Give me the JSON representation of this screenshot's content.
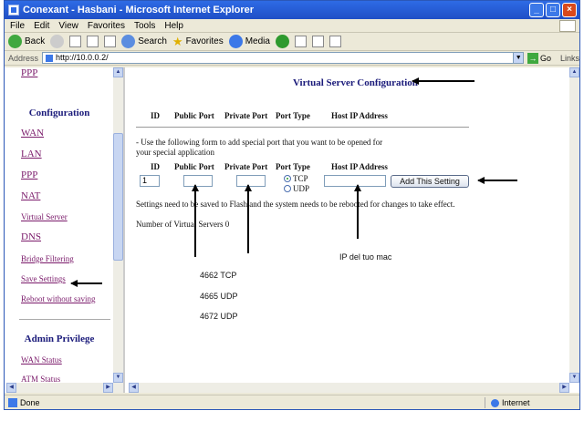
{
  "window": {
    "title": "Conexant - Hasbani - Microsoft Internet Explorer"
  },
  "menu": [
    "File",
    "Edit",
    "View",
    "Favorites",
    "Tools",
    "Help"
  ],
  "toolbar": {
    "back": "Back",
    "search": "Search",
    "favorites": "Favorites",
    "media": "Media"
  },
  "address": {
    "label": "Address",
    "url": "http://10.0.0.2/",
    "go": "Go",
    "links": "Links"
  },
  "sidebar": {
    "top_link": "PPP",
    "section1": "Configuration",
    "items": [
      "WAN",
      "LAN",
      "PPP",
      "NAT",
      "Virtual Server",
      "DNS",
      "Bridge Filtering",
      "Save Settings",
      "Reboot without saving"
    ],
    "section2": "Admin Privilege",
    "admin_items": [
      "WAN Status",
      "ATM Status"
    ]
  },
  "main": {
    "title": "Virtual Server Configuration",
    "table_headers": [
      "ID",
      "Public Port",
      "Private Port",
      "Port Type",
      "Host IP Address"
    ],
    "instructions_line1": "- Use the following form to add special port that you want to be opened for",
    "instructions_line2": "your special application",
    "form_headers": [
      "ID",
      "Public Port",
      "Private Port",
      "Port Type",
      "Host IP Address"
    ],
    "id_value": "1",
    "public_port_value": "",
    "private_port_value": "",
    "host_ip_value": "",
    "radio_tcp": "TCP",
    "radio_udp": "UDP",
    "add_button": "Add This Setting",
    "note": "Settings need to be saved to Flash and the system needs to be rebooted for changes to take effect.",
    "count_label": "Number of Virtual Servers 0"
  },
  "annotations": {
    "ip": "IP del tuo mac",
    "port1": "4662 TCP",
    "port2": "4665 UDP",
    "port3": "4672 UDP"
  },
  "status": {
    "left": "Done",
    "zone": "Internet"
  }
}
